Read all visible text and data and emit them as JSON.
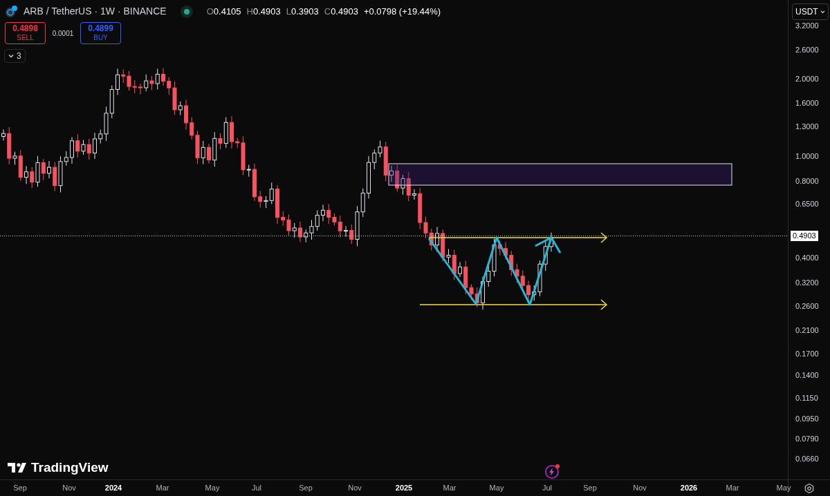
{
  "header": {
    "title": "ARB / TetherUS · 1W · BINANCE",
    "ohlc": [
      {
        "label": "O",
        "value": "0.4105"
      },
      {
        "label": "H",
        "value": "0.4903"
      },
      {
        "label": "L",
        "value": "0.3903"
      },
      {
        "label": "C",
        "value": "0.4903"
      }
    ],
    "change": "+0.0798 (+19.44%)"
  },
  "trade": {
    "sell": {
      "price": "0.4898",
      "label": "SELL"
    },
    "spread": "0.0001",
    "buy": {
      "price": "0.4899",
      "label": "BUY"
    }
  },
  "indicators_toggle": "3",
  "branding": "TradingView",
  "currency": "USDT",
  "price_axis": {
    "labels": [
      "3.2000",
      "2.6000",
      "2.0000",
      "1.6000",
      "1.3000",
      "1.0000",
      "0.8000",
      "0.6500",
      "0.4000",
      "0.3200",
      "0.2600",
      "0.2100",
      "0.1700",
      "0.1400",
      "0.1150",
      "0.0950",
      "0.0790",
      "0.0660"
    ],
    "last_price": "0.4903"
  },
  "time_axis": {
    "labels": [
      {
        "text": "Sep",
        "kind": "month"
      },
      {
        "text": "Nov",
        "kind": "month"
      },
      {
        "text": "2024",
        "kind": "year"
      },
      {
        "text": "Mar",
        "kind": "month"
      },
      {
        "text": "May",
        "kind": "month"
      },
      {
        "text": "Jul",
        "kind": "month"
      },
      {
        "text": "Sep",
        "kind": "month"
      },
      {
        "text": "Nov",
        "kind": "month"
      },
      {
        "text": "2025",
        "kind": "year"
      },
      {
        "text": "Mar",
        "kind": "month"
      },
      {
        "text": "May",
        "kind": "month"
      },
      {
        "text": "Jul",
        "kind": "month"
      },
      {
        "text": "Sep",
        "kind": "month"
      },
      {
        "text": "Nov",
        "kind": "month"
      },
      {
        "text": "2026",
        "kind": "year"
      },
      {
        "text": "Mar",
        "kind": "month"
      },
      {
        "text": "May",
        "kind": "month"
      }
    ]
  }
}
